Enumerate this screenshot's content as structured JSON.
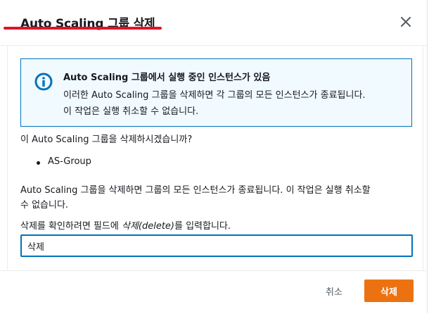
{
  "modal": {
    "title": "Auto Scaling 그룹 삭제",
    "close_icon": "close-icon"
  },
  "alert": {
    "icon": "info-icon",
    "title": "Auto Scaling 그룹에서 실행 중인 인스턴스가 있음",
    "line1": "이러한 Auto Scaling 그룹을 삭제하면 각 그룹의 모든 인스턴스가 종료됩니다.",
    "line2": "이 작업은 실행 취소할 수 없습니다."
  },
  "confirm_question": "이 Auto Scaling 그룹을 삭제하시겠습니까?",
  "groups": [
    "AS-Group"
  ],
  "warning": {
    "line1": "Auto Scaling 그룹을 삭제하면 그룹의 모든 인스턴스가 종료됩니다. 이 작업은 실행 취소할",
    "line2": "수 없습니다."
  },
  "instruction": {
    "prefix": "삭제를 확인하려면 필드에 ",
    "keyword": "삭제(delete)",
    "suffix": "를 입력합니다."
  },
  "input": {
    "value": "삭제",
    "placeholder": ""
  },
  "footer": {
    "cancel_label": "취소",
    "delete_label": "삭제"
  },
  "colors": {
    "accent_underline": "#e0142a",
    "alert_border": "#0073bb",
    "alert_bg": "#f1faff",
    "primary_button": "#ec7211"
  }
}
